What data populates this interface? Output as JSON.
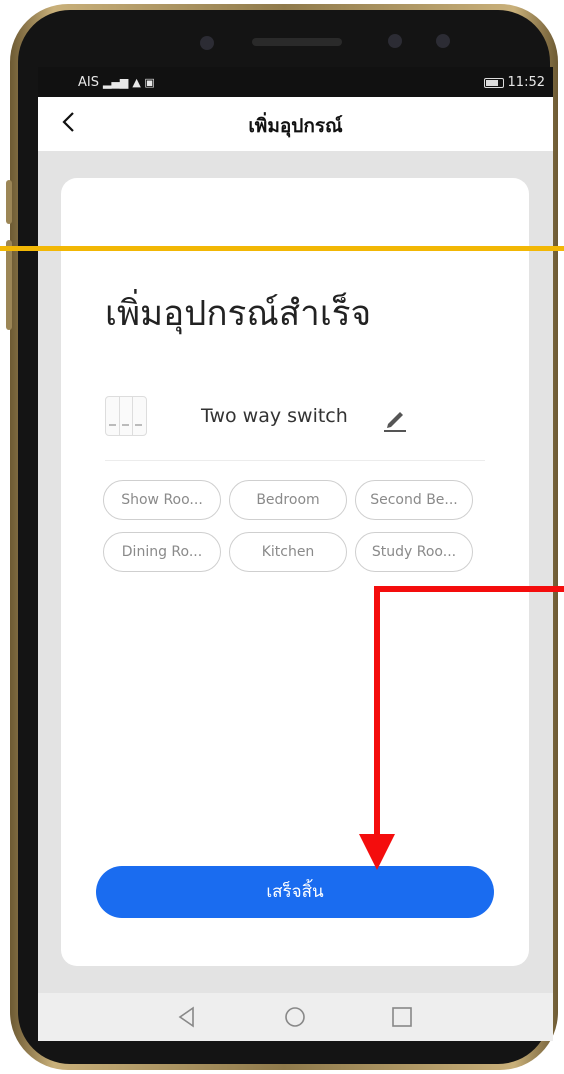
{
  "status_bar": {
    "carrier": "AIS",
    "signal_icon": "signal-icon",
    "notification_icon": "notification-icon",
    "time": "11:52"
  },
  "nav": {
    "title": "เพิ่มอุปกรณ์",
    "back_icon": "chevron-left-icon"
  },
  "card": {
    "title": "เพิ่มอุปกรณ์สำเร็จ",
    "device_name": "Two way switch",
    "rooms": [
      "Show Roo...",
      "Bedroom",
      "Second Be...",
      "Dining Ro...",
      "Kitchen",
      "Study Roo..."
    ],
    "done_label": "เสร็จสิ้น"
  },
  "colors": {
    "accent": "#1a6cf0",
    "annotation_line": "#f2b705",
    "annotation_arrow": "#f40d0d"
  }
}
